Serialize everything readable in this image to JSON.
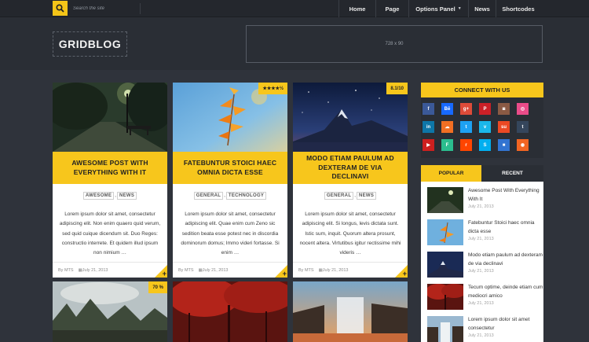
{
  "search": {
    "placeholder": "Search the site"
  },
  "nav": {
    "home": "Home",
    "page": "Page",
    "options_panel": "Options Panel",
    "news": "News",
    "shortcodes": "Shortcodes"
  },
  "header": {
    "logo": "GRIDBLOG",
    "ad": "728 x 90"
  },
  "posts": [
    {
      "title_1": "AWESOME POST WITH",
      "title_2": "EVERYTHING WITH IT",
      "tags": [
        "AWESOME",
        "NEWS"
      ],
      "excerpt": "Lorem ipsum dolor sit amet, consectetur adipiscing elit. Non enim quaero quid verum, sed quid cuique dicendum sit. Duo Reges: constructio interrete. Et quidem illud ipsum non nimium …",
      "author": "By MTS",
      "date": "July 21, 2013"
    },
    {
      "title_1": "FATEBUNTUR STOICI HAEC",
      "title_2": "OMNIA DICTA ESSE",
      "tags": [
        "GENERAL",
        "TECHNOLOGY"
      ],
      "excerpt": "Lorem ipsum dolor sit amet, consectetur adipiscing elit. Quae enim cum Zeno sic sedition beata esse potest nec in discordia dominorum domus; Immo videri fortasse. Si enim …",
      "author": "By MTS",
      "date": "July 21, 2013",
      "rating": "★★★★½"
    },
    {
      "title_1": "MODO ETIAM PAULUM AD",
      "title_2": "DEXTERAM DE VIA DECLINAVI",
      "tags": [
        "GENERAL",
        "NEWS"
      ],
      "excerpt": "Lorem ipsum dolor sit amet, consectetur adipiscing elit. Si longus, levis dictata sunt. Istic sum, inquit. Quorum altera prosunt, nocent altera. Virtutibus igitur rectissime mihi videris …",
      "author": "By MTS",
      "date": "July 21, 2013",
      "rating": "8.1/10"
    }
  ],
  "bottom_posts": [
    {
      "rating": "70 %"
    },
    {},
    {}
  ],
  "sidebar": {
    "connect_title": "CONNECT WITH US",
    "social": [
      {
        "icon": "facebook-icon",
        "glyph": "f",
        "color": "#3b5998"
      },
      {
        "icon": "behance-icon",
        "glyph": "Bē",
        "color": "#1769ff"
      },
      {
        "icon": "google-plus-icon",
        "glyph": "g+",
        "color": "#dd4b39"
      },
      {
        "icon": "pinterest-icon",
        "glyph": "P",
        "color": "#cb2027"
      },
      {
        "icon": "instagram-icon",
        "glyph": "◙",
        "color": "#8a5a44"
      },
      {
        "icon": "dribbble-icon",
        "glyph": "◎",
        "color": "#ea4c89"
      },
      {
        "icon": "linkedin-icon",
        "glyph": "in",
        "color": "#0e76a8"
      },
      {
        "icon": "soundcloud-icon",
        "glyph": "☁",
        "color": "#f26f23"
      },
      {
        "icon": "twitter-icon",
        "glyph": "t",
        "color": "#1da1f2"
      },
      {
        "icon": "vimeo-icon",
        "glyph": "v",
        "color": "#1ab7ea"
      },
      {
        "icon": "stumbleupon-icon",
        "glyph": "su",
        "color": "#eb4924"
      },
      {
        "icon": "tumblr-icon",
        "glyph": "t",
        "color": "#35465c"
      },
      {
        "icon": "youtube-icon",
        "glyph": "▶",
        "color": "#cd201f"
      },
      {
        "icon": "flickr-icon",
        "glyph": "F",
        "color": "#2bbd8e"
      },
      {
        "icon": "reddit-icon",
        "glyph": "r",
        "color": "#ff4500"
      },
      {
        "icon": "skype-icon",
        "glyph": "S",
        "color": "#00aff0"
      },
      {
        "icon": "delicious-icon",
        "glyph": "■",
        "color": "#3274d1"
      },
      {
        "icon": "rss-icon",
        "glyph": "◉",
        "color": "#f26522"
      }
    ],
    "tab_popular": "POPULAR",
    "tab_recent": "RECENT",
    "items": [
      {
        "title": "Awesome Post With Everything With It",
        "date": "July 21, 2013"
      },
      {
        "title": "Fatebuntur Stoici haec omnia dicta esse",
        "date": "July 21, 2013"
      },
      {
        "title": "Modo etiam paulum ad dexteram de via declinavi",
        "date": "July 21, 2013"
      },
      {
        "title": "Tecum optime, deinde etiam cum mediocri amico",
        "date": "July 21, 2013"
      },
      {
        "title": "Lorem ipsum dolor sit amet consectetur",
        "date": "July 21, 2013"
      }
    ]
  },
  "colors": {
    "accent": "#f7c61c",
    "background": "#2f333b",
    "topbar": "#24272d"
  }
}
